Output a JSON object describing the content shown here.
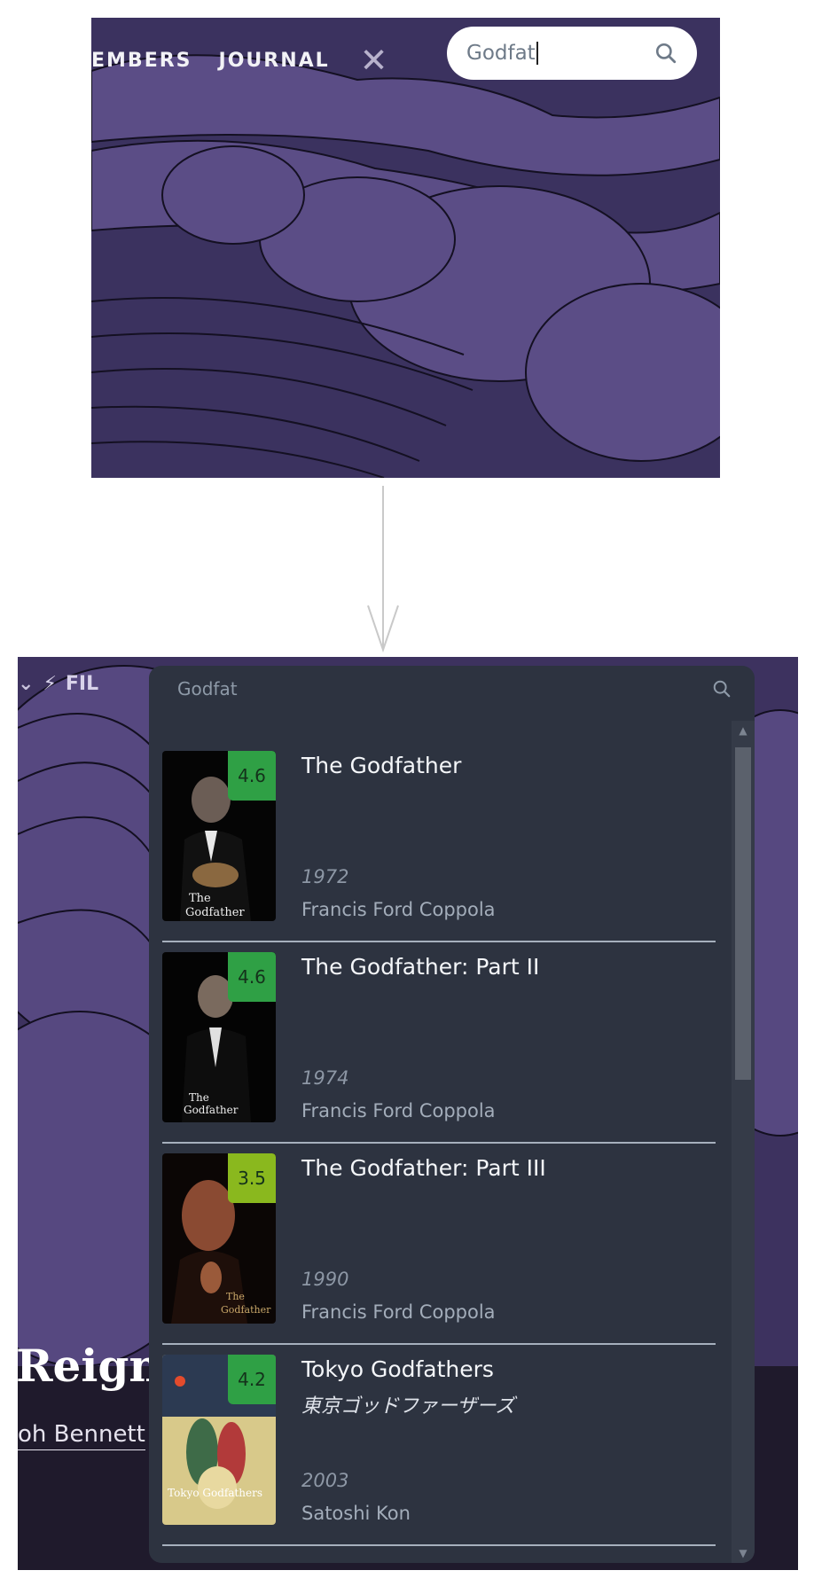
{
  "panel1": {
    "nav": [
      "EMBERS",
      "JOURNAL"
    ],
    "search": {
      "value": "Godfat"
    }
  },
  "panel2": {
    "nav_partial": "FIL",
    "hero_title_partial": "Reign",
    "hero_byline_partial": "oh Bennett",
    "dropdown": {
      "query": "Godfat",
      "results": [
        {
          "title": "The Godfather",
          "alt_title": "",
          "year": "1972",
          "director": "Francis Ford Coppola",
          "rating": "4.6",
          "rating_color": "#2fa045"
        },
        {
          "title": "The Godfather: Part II",
          "alt_title": "",
          "year": "1974",
          "director": "Francis Ford Coppola",
          "rating": "4.6",
          "rating_color": "#2fa045"
        },
        {
          "title": "The Godfather: Part III",
          "alt_title": "",
          "year": "1990",
          "director": "Francis Ford Coppola",
          "rating": "3.5",
          "rating_color": "#8ab81e"
        },
        {
          "title": "Tokyo Godfathers",
          "alt_title": "東京ゴッドファーザーズ",
          "year": "2003",
          "director": "Satoshi Kon",
          "rating": "4.2",
          "rating_color": "#2fa045"
        }
      ]
    }
  },
  "colors": {
    "accent_green": "#2fa045",
    "accent_lime": "#8ab81e",
    "panel_bg": "#2d3340"
  }
}
